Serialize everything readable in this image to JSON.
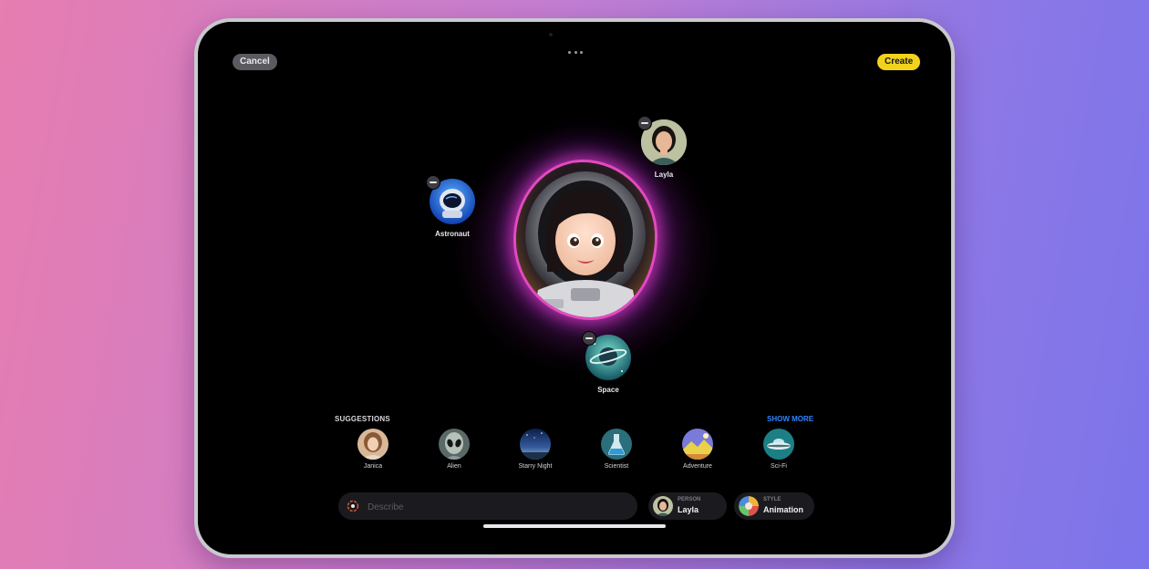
{
  "toolbar": {
    "cancel_label": "Cancel",
    "create_label": "Create"
  },
  "canvas": {
    "bubbles": [
      {
        "label": "Layla",
        "icon": "person-photo-icon"
      },
      {
        "label": "Astronaut",
        "icon": "astronaut-helmet-icon"
      },
      {
        "label": "Space",
        "icon": "planet-icon"
      }
    ]
  },
  "suggestions": {
    "title": "SUGGESTIONS",
    "show_more": "SHOW MORE",
    "items": [
      {
        "label": "Janica",
        "icon": "person-photo-icon"
      },
      {
        "label": "Alien",
        "icon": "alien-icon"
      },
      {
        "label": "Starry Night",
        "icon": "night-sky-icon"
      },
      {
        "label": "Scientist",
        "icon": "flask-icon"
      },
      {
        "label": "Adventure",
        "icon": "landscape-icon"
      },
      {
        "label": "Sci-Fi",
        "icon": "ufo-icon"
      }
    ]
  },
  "composer": {
    "placeholder": "Describe",
    "person": {
      "caption": "PERSON",
      "value": "Layla"
    },
    "style": {
      "caption": "STYLE",
      "value": "Animation"
    }
  },
  "colors": {
    "accent_yellow": "#f2d31b",
    "link_blue": "#2f84ff",
    "glow_magenta": "#e14bc0"
  }
}
